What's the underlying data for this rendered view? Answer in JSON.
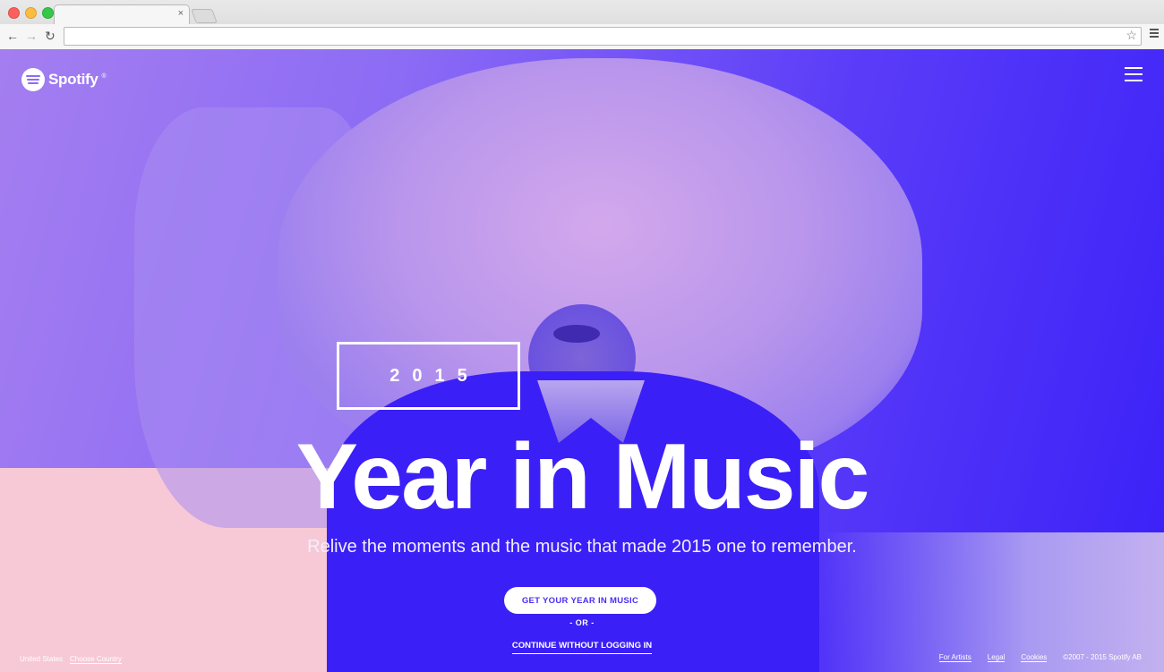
{
  "browser": {
    "tab_close": "×",
    "back_icon": "←",
    "forward_icon": "→",
    "reload_icon": "↻",
    "star_icon": "☆"
  },
  "header": {
    "brand": "Spotify",
    "brand_mark": "®"
  },
  "hero": {
    "year": "2015",
    "headline": "Year in Music",
    "subtitle": "Relive the moments and the music that made 2015 one to remember.",
    "cta_label": "GET YOUR YEAR IN MUSIC",
    "or_label": "- OR -",
    "continue_label": "CONTINUE WITHOUT LOGGING IN"
  },
  "footer": {
    "country": "United States",
    "choose_country": "Choose Country",
    "links": [
      "For Artists",
      "Legal",
      "Cookies"
    ],
    "copyright": "©2007 - 2015 Spotify AB"
  },
  "colors": {
    "accent": "#4a2df5",
    "pink": "#f7c9d6"
  }
}
